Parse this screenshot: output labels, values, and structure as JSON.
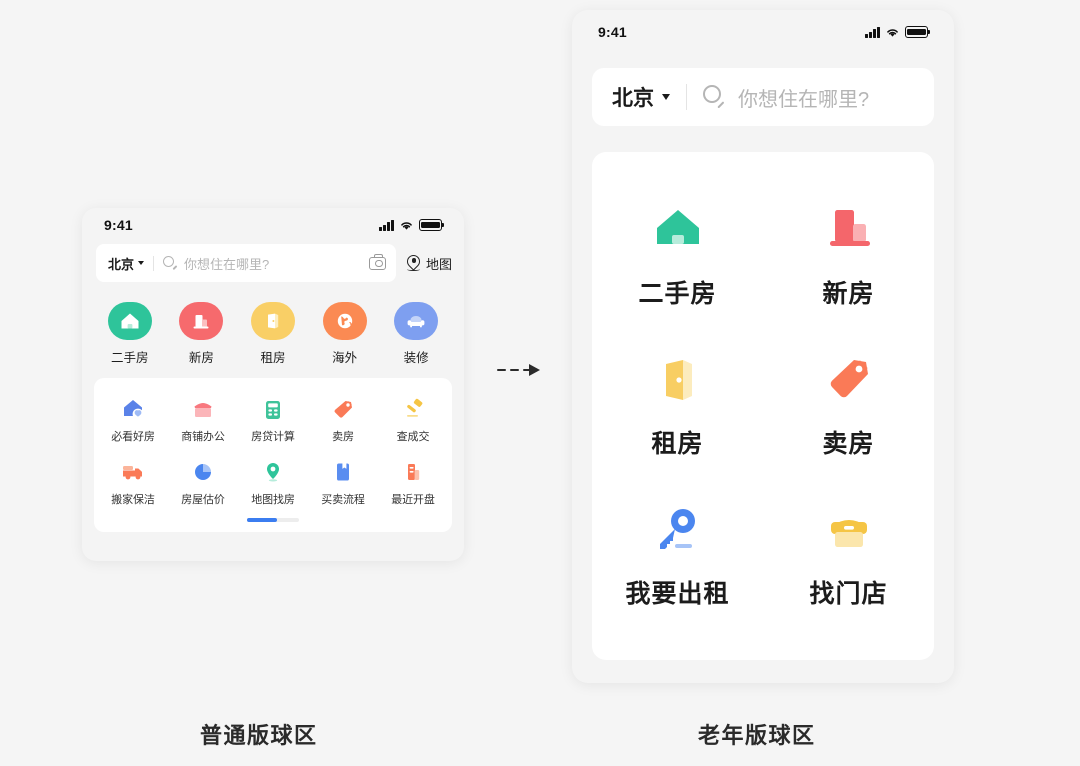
{
  "page": {
    "background": "#f5f5f5",
    "caption_left": "普通版球区",
    "caption_right": "老年版球区",
    "arrow": "dashed-right-arrow"
  },
  "normal_version": {
    "status_bar": {
      "time": "9:41",
      "signal_icon": "cellular-signal-icon",
      "wifi_icon": "wifi-icon",
      "battery_icon": "battery-full-icon"
    },
    "search": {
      "city": "北京",
      "caret_icon": "chevron-down-icon",
      "search_icon": "search-icon",
      "placeholder": "你想住在哪里?",
      "camera_icon": "camera-icon",
      "map_icon": "map-pin-icon",
      "map_label": "地图"
    },
    "top_entries": [
      {
        "label": "二手房",
        "icon": "house-icon",
        "color": "#2ec49a"
      },
      {
        "label": "新房",
        "icon": "buildings-icon",
        "color": "#f66a6d"
      },
      {
        "label": "租房",
        "icon": "door-icon",
        "color": "#f9cf66"
      },
      {
        "label": "海外",
        "icon": "globe-icon",
        "color": "#fb8a53"
      },
      {
        "label": "装修",
        "icon": "sofa-icon",
        "color": "#7e9ff0"
      }
    ],
    "grid_entries": [
      {
        "label": "必看好房",
        "icon": "house-shield-icon",
        "color": "#5a82e8"
      },
      {
        "label": "商铺办公",
        "icon": "shop-icon",
        "color": "#f8787f"
      },
      {
        "label": "房贷计算",
        "icon": "calculator-icon",
        "color": "#3fc39a"
      },
      {
        "label": "卖房",
        "icon": "price-tag-icon",
        "color": "#fa7a57"
      },
      {
        "label": "查成交",
        "icon": "gavel-icon",
        "color": "#f5c545"
      },
      {
        "label": "搬家保洁",
        "icon": "truck-icon",
        "color": "#fa7a57"
      },
      {
        "label": "房屋估价",
        "icon": "pie-chart-icon",
        "color": "#4b86ef"
      },
      {
        "label": "地图找房",
        "icon": "location-pin-icon",
        "color": "#2ec49a"
      },
      {
        "label": "买卖流程",
        "icon": "book-icon",
        "color": "#5a8df0"
      },
      {
        "label": "最近开盘",
        "icon": "building-icon",
        "color": "#fa7a57"
      }
    ],
    "pager": {
      "indicator": "page-progress-bar",
      "active_color": "#3b7df0"
    }
  },
  "senior_version": {
    "status_bar": {
      "time": "9:41",
      "signal_icon": "cellular-signal-icon",
      "wifi_icon": "wifi-icon",
      "battery_icon": "battery-full-icon"
    },
    "search": {
      "city": "北京",
      "caret_icon": "chevron-down-icon",
      "search_icon": "search-icon",
      "placeholder": "你想住在哪里?"
    },
    "entries": [
      {
        "label": "二手房",
        "icon": "house-icon",
        "color": "#2ec49a"
      },
      {
        "label": "新房",
        "icon": "buildings-icon",
        "color": "#f4666b"
      },
      {
        "label": "租房",
        "icon": "door-icon",
        "color": "#f8ce63"
      },
      {
        "label": "卖房",
        "icon": "price-tag-icon",
        "color": "#fa7a57"
      },
      {
        "label": "我要出租",
        "icon": "key-icon",
        "color": "#4b86ef"
      },
      {
        "label": "找门店",
        "icon": "store-box-icon",
        "color": "#f5c545"
      }
    ]
  }
}
